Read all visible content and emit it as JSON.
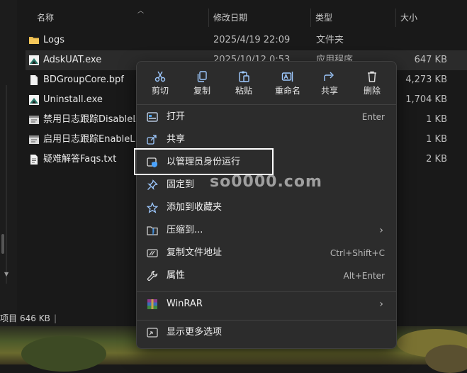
{
  "columns": {
    "name": "名称",
    "date": "修改日期",
    "type": "类型",
    "size": "大小"
  },
  "files": [
    {
      "name": "Logs",
      "date": "2025/4/19 22:09",
      "type": "文件夹",
      "size": "",
      "icon": "folder-icon"
    },
    {
      "name": "AdskUAT.exe",
      "date": "2025/10/12 0:53",
      "type": "应用程序",
      "size": "647 KB",
      "icon": "autodesk-app-icon"
    },
    {
      "name": "BDGroupCore.bpf",
      "date": "",
      "type": "",
      "size": "4,273 KB",
      "icon": "file-icon"
    },
    {
      "name": "Uninstall.exe",
      "date": "",
      "type": "",
      "size": "1,704 KB",
      "icon": "autodesk-app-icon"
    },
    {
      "name": "禁用日志跟踪DisableLog",
      "date": "",
      "type": "",
      "size": "1 KB",
      "icon": "script-icon"
    },
    {
      "name": "启用日志跟踪EnableLog",
      "date": "",
      "type": "",
      "size": "1 KB",
      "icon": "script-icon"
    },
    {
      "name": "疑难解答Faqs.txt",
      "date": "",
      "type": "",
      "size": "2 KB",
      "icon": "text-file-icon"
    }
  ],
  "status": {
    "count_label": "项目",
    "size": "646 KB",
    "separator": "|"
  },
  "context_menu": {
    "quick_actions": [
      {
        "label": "剪切",
        "icon": "scissors-icon"
      },
      {
        "label": "复制",
        "icon": "copy-icon"
      },
      {
        "label": "粘贴",
        "icon": "paste-icon"
      },
      {
        "label": "重命名",
        "icon": "rename-icon"
      },
      {
        "label": "共享",
        "icon": "share-icon"
      },
      {
        "label": "删除",
        "icon": "trash-icon"
      }
    ],
    "items": [
      {
        "label": "打开",
        "shortcut": "Enter",
        "icon": "open-icon"
      },
      {
        "label": "共享",
        "shortcut": "",
        "icon": "share-icon"
      },
      {
        "label": "以管理员身份运行",
        "shortcut": "",
        "icon": "shield-icon"
      },
      {
        "label": "固定到",
        "shortcut": "",
        "icon": "pin-icon"
      },
      {
        "label": "添加到收藏夹",
        "shortcut": "",
        "icon": "star-icon"
      },
      {
        "label": "压缩到...",
        "shortcut": "",
        "icon": "zip-icon",
        "submenu": true
      },
      {
        "label": "复制文件地址",
        "shortcut": "Ctrl+Shift+C",
        "icon": "copy-path-icon"
      },
      {
        "label": "属性",
        "shortcut": "Alt+Enter",
        "icon": "wrench-icon"
      },
      {
        "label": "WinRAR",
        "shortcut": "",
        "icon": "winrar-icon",
        "submenu": true
      },
      {
        "label": "显示更多选项",
        "shortcut": "",
        "icon": "more-options-icon"
      }
    ],
    "submenu_arrow": "›"
  },
  "watermark": "so0000.com",
  "colors": {
    "background": "#191919",
    "menu": "#2c2c2c",
    "accent": "#4aa3ff"
  }
}
